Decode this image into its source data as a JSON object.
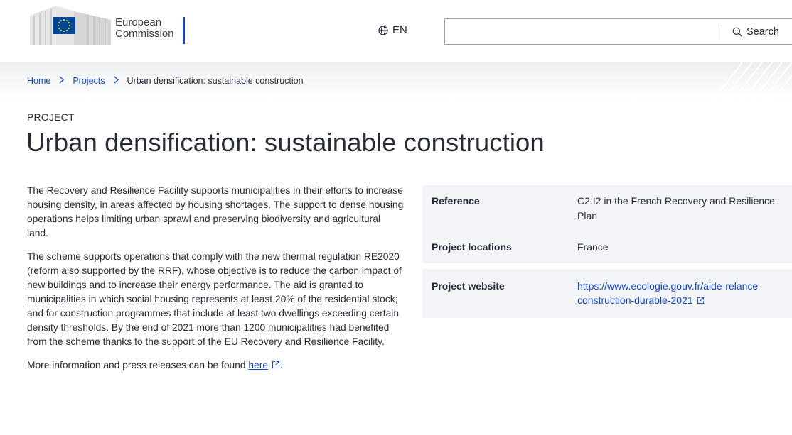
{
  "header": {
    "logo": {
      "line1": "European",
      "line2": "Commission"
    },
    "language": "EN",
    "search": {
      "placeholder": "",
      "value": "",
      "button_label": "Search"
    },
    "colors": {
      "accent": "#0e47cb",
      "eu_flag": "#004494",
      "eu_stars": "#ffed00"
    }
  },
  "breadcrumb": {
    "items": [
      {
        "label": "Home",
        "link": true
      },
      {
        "label": "Projects",
        "link": true
      },
      {
        "label": "Urban densification: sustainable construction",
        "link": false
      }
    ],
    "separator": ">"
  },
  "page": {
    "label": "PROJECT",
    "title": "Urban densification: sustainable construction"
  },
  "body": {
    "paragraphs": [
      "The Recovery and Resilience Facility supports municipalities in their efforts to increase housing density, in areas affected by housing shortages. The support to dense housing operations helps limiting urban sprawl and preserving biodiversity and agricultural land.",
      "The scheme supports operations that comply with the new thermal regulation RE2020 (reform also supported by the RRF), whose objective is to reduce the carbon impact of new buildings and to increase their energy performance. The aid is granted to municipalities in which social housing represents at least 20% of the residential stock; and for construction programmes that include at least two dwellings exceeding certain density thresholds. By the end of 2021 more than 1200 municipalities had benefited from the scheme thanks to the support of the EU Recovery and Resilience Facility."
    ],
    "more_info": {
      "prefix": "More information and press releases can be found ",
      "link_text": "here",
      "suffix": "."
    }
  },
  "info": {
    "rows": [
      {
        "key": "Reference",
        "value": "C2.I2 in the French Recovery and Resilience Plan"
      },
      {
        "key": "Project locations",
        "value": "France"
      },
      {
        "key": "Project website",
        "value": "https://www.ecologie.gouv.fr/aide-relance-construction-durable-2021",
        "link": true
      }
    ]
  }
}
